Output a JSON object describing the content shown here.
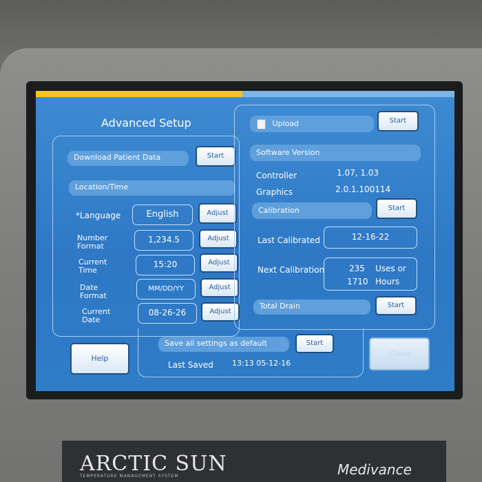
{
  "screen": {
    "title": "Advanced Setup",
    "download": {
      "label": "Download Patient Data",
      "button": "Start"
    },
    "location_time": {
      "header": "Location/Time",
      "rows": [
        {
          "label": "*Language",
          "value": "English",
          "button": "Adjust"
        },
        {
          "label": "Number\nFormat",
          "value": "1,234.5",
          "button": "Adjust"
        },
        {
          "label": "Current\nTime",
          "value": "15:20",
          "button": "Adjust"
        },
        {
          "label": "Date\nFormat",
          "value": "MM/DD/YY",
          "button": "Adjust"
        },
        {
          "label": "Current\nDate",
          "value": "08-26-26",
          "button": "Adjust"
        }
      ]
    },
    "upload": {
      "label": "Upload",
      "button": "Start"
    },
    "software_version": {
      "header": "Software Version",
      "controller_label": "Controller",
      "controller_value": "1.07, 1.03",
      "graphics_label": "Graphics",
      "graphics_value": "2.0.1.100114"
    },
    "calibration": {
      "header": "Calibration",
      "button": "Start",
      "last_label": "Last Calibrated",
      "last_value": "12-16-22",
      "next_label": "Next Calibration",
      "uses_value": "235",
      "uses_unit": "Uses or",
      "hours_value": "1710",
      "hours_unit": "Hours"
    },
    "total_drain": {
      "label": "Total Drain",
      "button": "Start"
    },
    "save_default": {
      "label": "Save all settings as default",
      "button": "Start"
    },
    "last_saved": {
      "label": "Last Saved",
      "value": "13:13 05-12-16"
    },
    "help_button": "Help",
    "close_button": "Close"
  },
  "device": {
    "brand": "ARCTIC SUN",
    "brand_sub": "TEMPERATURE MANAGEMENT SYSTEM",
    "maker": "Medivance"
  },
  "colors": {
    "screen_bg": "#2e78c6",
    "header_bar": "#5e9fdc",
    "button_face": "#ffffff",
    "top_strip": "#f6c51c"
  }
}
